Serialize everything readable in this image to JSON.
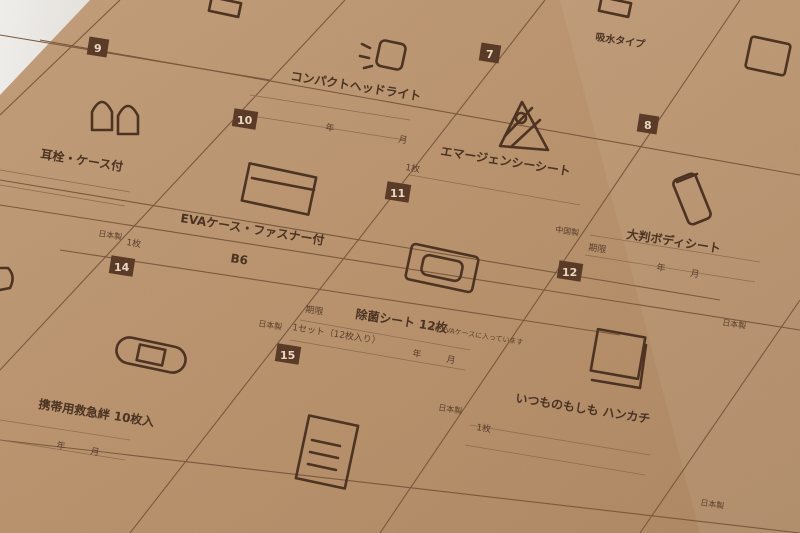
{
  "items": [
    {
      "number": "9",
      "title": "耳栓・ケース付",
      "icon": "earplugs-icon"
    },
    {
      "number": "10",
      "title": "EVAケース・ファスナー付",
      "subtitle": "B6",
      "qty": "1枚",
      "icon": "zipper-case-icon"
    },
    {
      "number": "7",
      "title": "エマージェンシーシート",
      "qty": "1枚",
      "icon": "emergency-sheet-icon"
    },
    {
      "number": "8",
      "title": "大判ボディシート",
      "expiry_label": "期限",
      "icon": "body-sheet-icon"
    },
    {
      "number": "11",
      "title": "除菌シート 12枚",
      "qty": "1セット（12枚入り）",
      "expiry_label": "期限",
      "note": "10 EVAケースに入っています",
      "icon": "wet-wipes-icon"
    },
    {
      "number": "12",
      "title": "いつものもしも ハンカチ",
      "qty": "1枚",
      "icon": "handkerchief-icon"
    },
    {
      "number": "14",
      "title": "携帯用救急絆 10枚入",
      "icon": "bandage-icon"
    },
    {
      "number": "15",
      "icon": "document-icon"
    }
  ],
  "top_row": [
    {
      "title": "コンパクトヘッドライト",
      "icon": "headlight-icon"
    },
    {
      "title": "吸水タイプ"
    }
  ],
  "labels": {
    "made_in_japan": "日本製",
    "made_in_china": "中国製",
    "year": "年",
    "month": "月"
  }
}
